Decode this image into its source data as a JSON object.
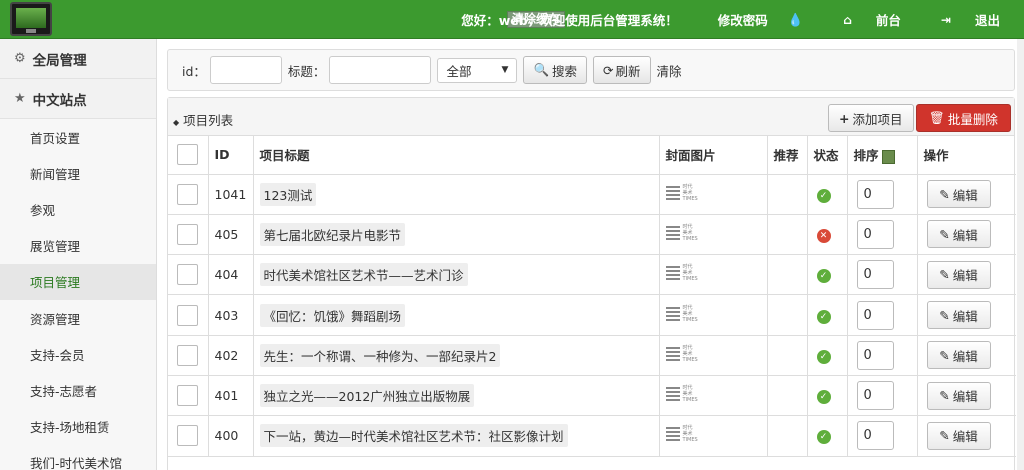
{
  "topbar": {
    "cache_label": "清除缓存",
    "greeting": "您好：web，欢迎使用后台管理系统！",
    "change_password": "修改密码",
    "drop_icon": "droplet-icon",
    "frontend": "前台",
    "logout": "退出",
    "colors": {
      "bar": "#3c9a2f"
    }
  },
  "sidebar": {
    "global_manage": "全局管理",
    "cn_site": "中文站点",
    "items": [
      {
        "label": "首页设置"
      },
      {
        "label": "新闻管理"
      },
      {
        "label": "参观"
      },
      {
        "label": "展览管理"
      },
      {
        "label": "项目管理",
        "active": true
      },
      {
        "label": "资源管理"
      },
      {
        "label": "支持-会员"
      },
      {
        "label": "支持-志愿者"
      },
      {
        "label": "支持-场地租赁"
      },
      {
        "label": "我们-时代美术馆"
      }
    ]
  },
  "search": {
    "id_label": "id：",
    "title_label": "标题：",
    "select_value": "全部",
    "search_btn": "搜索",
    "refresh_btn": "刷新",
    "clear_link": "清除"
  },
  "list": {
    "title": "项目列表",
    "add_btn": "添加项目",
    "batch_delete_btn": "批量删除",
    "columns": {
      "id": "ID",
      "title": "项目标题",
      "cover": "封面图片",
      "recommend": "推荐",
      "status": "状态",
      "sort": "排序",
      "action": "操作"
    },
    "edit_label": "编辑",
    "rows": [
      {
        "id": "1041",
        "title": "123测试",
        "status": "ok",
        "sort": "0"
      },
      {
        "id": "405",
        "title": "第七届北欧纪录片电影节",
        "status": "no",
        "sort": "0"
      },
      {
        "id": "404",
        "title": "时代美术馆社区艺术节——艺术门诊",
        "status": "ok",
        "sort": "0"
      },
      {
        "id": "403",
        "title": "《回忆：饥饿》舞蹈剧场",
        "status": "ok",
        "sort": "0"
      },
      {
        "id": "402",
        "title": "先生：一个称谓、一种修为、一部纪录片2",
        "status": "ok",
        "sort": "0"
      },
      {
        "id": "401",
        "title": "独立之光——2012广州独立出版物展",
        "status": "ok",
        "sort": "0"
      },
      {
        "id": "400",
        "title": "下一站，黄边—时代美术馆社区艺术节：社区影像计划",
        "status": "ok",
        "sort": "0"
      }
    ],
    "cover_mini_text": "时代 美术 TIMES"
  }
}
